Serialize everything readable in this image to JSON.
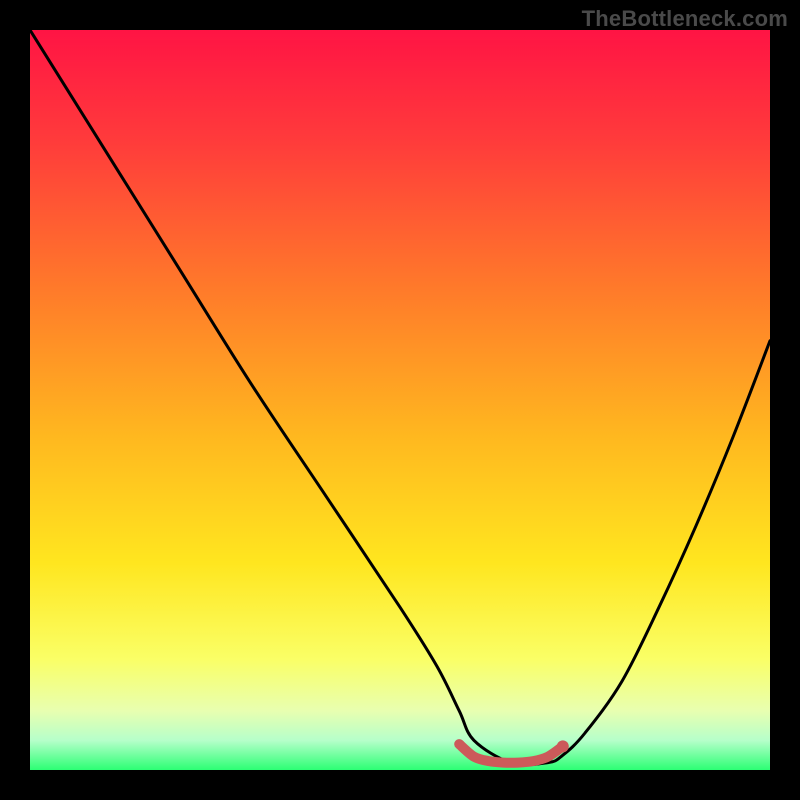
{
  "watermark": "TheBottleneck.com",
  "chart_data": {
    "type": "line",
    "title": "",
    "xlabel": "",
    "ylabel": "",
    "xlim": [
      0,
      100
    ],
    "ylim": [
      0,
      100
    ],
    "grid": false,
    "legend": false,
    "series": [
      {
        "name": "bottleneck-curve",
        "color": "#000000",
        "x": [
          0,
          10,
          20,
          30,
          40,
          50,
          55,
          58,
          60,
          65,
          70,
          72,
          75,
          80,
          85,
          90,
          95,
          100
        ],
        "y": [
          100,
          84,
          68,
          52,
          37,
          22,
          14,
          8,
          4,
          1,
          1,
          2,
          5,
          12,
          22,
          33,
          45,
          58
        ]
      },
      {
        "name": "optimal-range-marker",
        "color": "#cc5a5a",
        "x": [
          58,
          60,
          62,
          64,
          66,
          68,
          70,
          72
        ],
        "y": [
          3.5,
          1.8,
          1.2,
          1.0,
          1.0,
          1.2,
          1.8,
          3.2
        ]
      }
    ],
    "background_gradient": {
      "stops": [
        {
          "offset": 0.0,
          "color": "#ff1444"
        },
        {
          "offset": 0.15,
          "color": "#ff3b3b"
        },
        {
          "offset": 0.35,
          "color": "#ff7a2a"
        },
        {
          "offset": 0.55,
          "color": "#ffb81f"
        },
        {
          "offset": 0.72,
          "color": "#ffe61f"
        },
        {
          "offset": 0.85,
          "color": "#faff66"
        },
        {
          "offset": 0.92,
          "color": "#e8ffb0"
        },
        {
          "offset": 0.96,
          "color": "#b6ffca"
        },
        {
          "offset": 1.0,
          "color": "#2cff74"
        }
      ]
    }
  }
}
